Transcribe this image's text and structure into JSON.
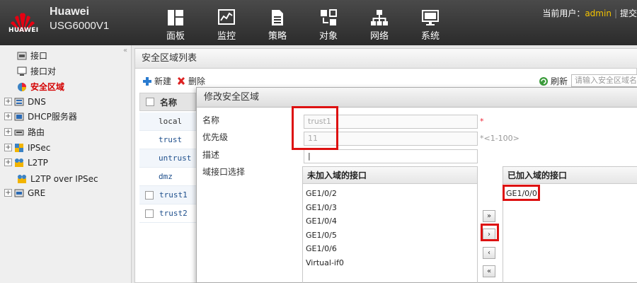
{
  "header": {
    "brand": "Huawei",
    "model": "USG6000V1",
    "logo_text": "HUAWEI",
    "nav": [
      {
        "label": "面板",
        "icon": "dashboard-icon"
      },
      {
        "label": "监控",
        "icon": "monitor-chart-icon"
      },
      {
        "label": "策略",
        "icon": "policy-document-icon"
      },
      {
        "label": "对象",
        "icon": "objects-icon"
      },
      {
        "label": "网络",
        "icon": "network-icon"
      },
      {
        "label": "系统",
        "icon": "system-computer-icon"
      }
    ],
    "user_prefix": "当前用户：",
    "user": "admin",
    "submit": "提交"
  },
  "sidebar": {
    "items": [
      {
        "label": "接口",
        "icon": "interface-icon"
      },
      {
        "label": "接口对",
        "icon": "interface-pair-icon"
      },
      {
        "label": "安全区域",
        "icon": "security-zone-icon"
      },
      {
        "label": "DNS",
        "icon": "dns-icon"
      },
      {
        "label": "DHCP服务器",
        "icon": "dhcp-server-icon"
      },
      {
        "label": "路由",
        "icon": "routing-icon"
      },
      {
        "label": "IPSec",
        "icon": "ipsec-icon"
      },
      {
        "label": "L2TP",
        "icon": "l2tp-icon"
      },
      {
        "label": "L2TP over IPSec",
        "icon": "l2tp-ipsec-icon"
      },
      {
        "label": "GRE",
        "icon": "gre-icon"
      }
    ]
  },
  "main": {
    "title": "安全区域列表",
    "new_label": "新建",
    "delete_label": "删除",
    "refresh_label": "刷新",
    "search_placeholder": "请输入安全区域名",
    "col_name": "名称",
    "rows": [
      "local",
      "trust",
      "untrust",
      "dmz",
      "trust1",
      "trust2"
    ]
  },
  "dialog": {
    "title": "修改安全区域",
    "name_label": "名称",
    "name_value": "trust1",
    "priority_label": "优先级",
    "priority_value": "11",
    "priority_hint": "*<1-100>",
    "required_mark": "*",
    "desc_label": "描述",
    "desc_value": "",
    "iface_label": "域接口选择",
    "left_header": "未加入域的接口",
    "right_header": "已加入域的接口",
    "available": [
      "GE1/0/2",
      "GE1/0/3",
      "GE1/0/4",
      "GE1/0/5",
      "GE1/0/6",
      "Virtual-if0"
    ],
    "joined": [
      "GE1/0/0"
    ],
    "buttons": {
      "add_all": "»",
      "add": "›",
      "remove": "‹",
      "remove_all": "«"
    }
  },
  "colors": {
    "accent_red": "#d11111",
    "header_bg": "#333333",
    "user_yellow": "#f5c400",
    "link_blue": "#1e4f8c"
  }
}
